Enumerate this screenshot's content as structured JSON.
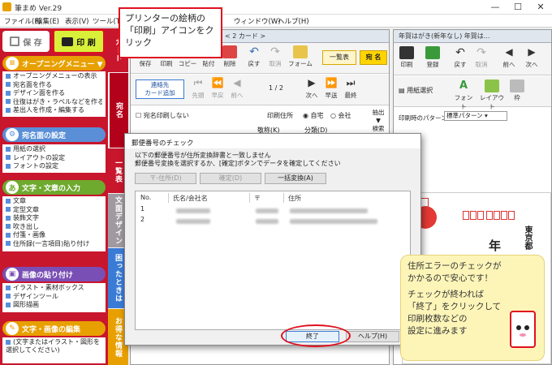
{
  "window": {
    "title": "筆まめ Ver.29"
  },
  "menu": [
    "ファイル(F)",
    "編集(E)",
    "表示(V)",
    "ツール(T)",
    "ウィンドウ(W)",
    "ヘルプ(H)"
  ],
  "left_panel": {
    "save_label": "保 存",
    "print_label": "印 刷",
    "sections": [
      {
        "title": "オープニングメニュー ▼",
        "items": [
          "オープニングメニューの表示",
          "宛名面を作る",
          "デザイン面を作る",
          "往復はがき・ラベルなどを作る",
          "差出人を作成・編集する"
        ]
      },
      {
        "title": "宛名面の設定",
        "items": [
          "用紙の選択",
          "レイアウトの設定",
          "フォントの設定"
        ]
      },
      {
        "title": "文字・文章の入力",
        "items": [
          "文章",
          "定型文章",
          "装飾文字",
          "吹き出し",
          "付箋・画像",
          "住所録(一言項目)貼り付け"
        ]
      },
      {
        "title": "画像の貼り付け",
        "items": [
          "イラスト・素材ボックス",
          "デザインツール",
          "図形描画"
        ]
      },
      {
        "title": "文字・画像の編集",
        "items": [
          "(文字またはイラスト・図形を選択してください)"
        ]
      }
    ]
  },
  "vertical_tabs": [
    "カード",
    "宛名",
    "一覧表",
    "文面デザイン",
    "困ったときは",
    "お得な情報"
  ],
  "card_window": {
    "title": "< 2 カード >",
    "toolbar": [
      "保存",
      "印刷",
      "コピー",
      "貼付",
      "削除",
      "戻す",
      "取消",
      "フォーム"
    ],
    "toolbar2": [
      "先頭",
      "早戻",
      "前へ",
      "次へ",
      "早送",
      "最終"
    ],
    "address_button": "連絡先\nカード追加",
    "list_button": "一覧表",
    "name_button": "宛 名",
    "page_indicator": "1 / 2",
    "print_toggle": "宛名印刷しない",
    "print_address_label": "印刷住所",
    "radio_home": "自宅",
    "radio_company": "会社",
    "extract_label": "抽出",
    "search_label": "検索",
    "honorific_label": "敬称(K)",
    "category_label": "分類(D)"
  },
  "right_window": {
    "title": "年賀はがき(新年なし) 年賀は...",
    "toolbar": [
      "印刷",
      "登録",
      "戻す",
      "取消",
      "前へ",
      "次へ"
    ],
    "toolbar2": [
      "用紙選択",
      "フォント",
      "レイアウト",
      "枠"
    ],
    "pattern_label": "印刷時のパターン",
    "pattern_value": "標準パターン",
    "postcard_year": "年",
    "postcard_addr": "東京都"
  },
  "dialog": {
    "title": "郵便番号のチェック",
    "message1": "以下の郵便番号が住所変換辞書と一致しません",
    "message2": "郵便番号変換を選択するか、[確定]ボタンでデータを確定してください",
    "btn_convert": "〒-住所(D)",
    "btn_confirm": "確定(D)",
    "btn_bulk": "一括変換(A)",
    "columns": [
      "No.",
      "氏名/会社名",
      "〒",
      "住所"
    ],
    "rows": [
      {
        "no": "1"
      },
      {
        "no": "2"
      }
    ],
    "btn_close": "終了",
    "btn_help": "ヘルプ(H)"
  },
  "callouts": {
    "print_tip": "プリンターの絵柄の「印刷」アイコンをクリック",
    "main_tip_1": "住所エラーのチェックが",
    "main_tip_2": "かかるので安心です！",
    "main_tip_3": "チェックが終われば",
    "main_tip_4": "「終了」をクリックして",
    "main_tip_5": "印刷枚数などの",
    "main_tip_6": "設定に進みます"
  },
  "colors": {
    "brand_red": "#c8162d",
    "highlight_red": "#e0101f",
    "callout_yellow": "#fdf5b8",
    "print_green": "#d8f03a"
  }
}
